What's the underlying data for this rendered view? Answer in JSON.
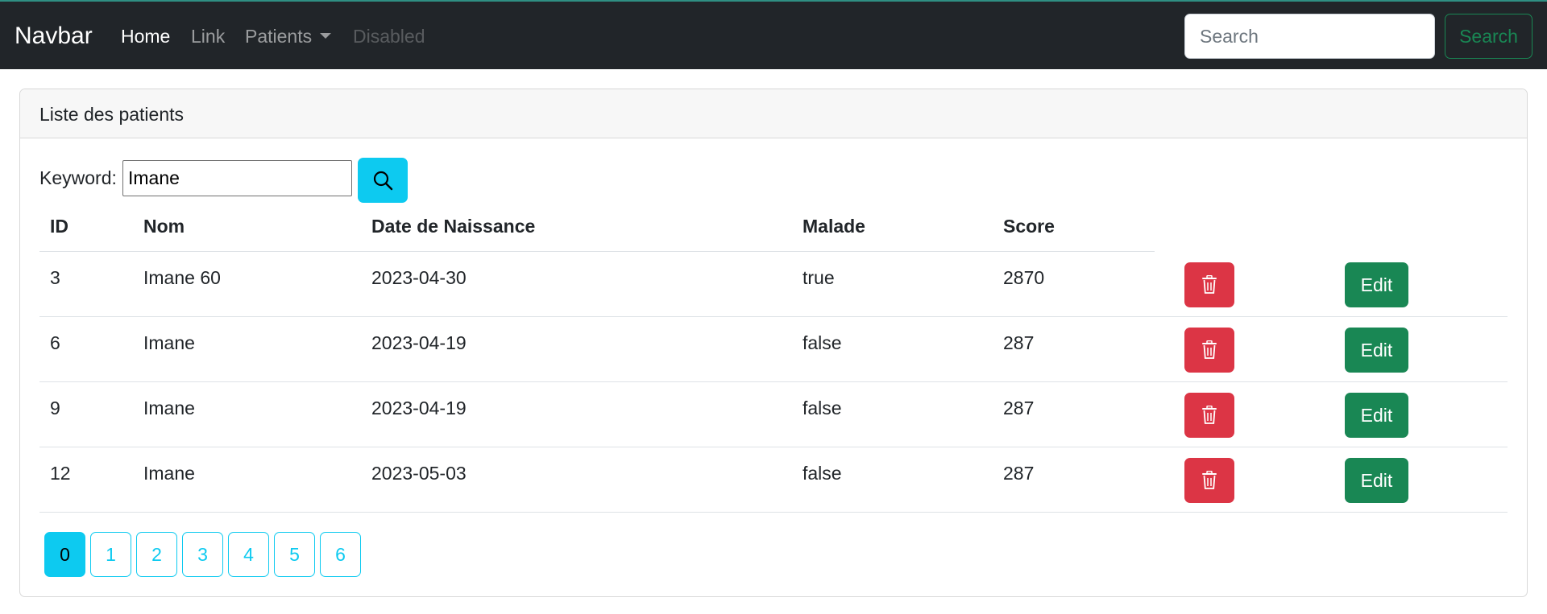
{
  "navbar": {
    "brand": "Navbar",
    "links": [
      {
        "label": "Home"
      },
      {
        "label": "Link"
      },
      {
        "label": "Patients"
      },
      {
        "label": "Disabled"
      }
    ],
    "search_placeholder": "Search",
    "search_button": "Search"
  },
  "card": {
    "header": "Liste des patients",
    "keyword_label": "Keyword:",
    "keyword_value": "Imane"
  },
  "table": {
    "columns": [
      "ID",
      "Nom",
      "Date de Naissance",
      "Malade",
      "Score"
    ],
    "rows": [
      {
        "id": "3",
        "nom": "Imane 60",
        "date": "2023-04-30",
        "malade": "true",
        "score": "2870"
      },
      {
        "id": "6",
        "nom": "Imane",
        "date": "2023-04-19",
        "malade": "false",
        "score": "287"
      },
      {
        "id": "9",
        "nom": "Imane",
        "date": "2023-04-19",
        "malade": "false",
        "score": "287"
      },
      {
        "id": "12",
        "nom": "Imane",
        "date": "2023-05-03",
        "malade": "false",
        "score": "287"
      }
    ],
    "edit_label": "Edit"
  },
  "pagination": {
    "pages": [
      "0",
      "1",
      "2",
      "3",
      "4",
      "5",
      "6"
    ],
    "current": "0"
  },
  "colors": {
    "navbar_bg": "#212529",
    "info": "#0dcaf0",
    "danger": "#dc3545",
    "success": "#198754"
  },
  "icons": {
    "keyword_button": "search-icon",
    "delete_button": "trash-icon"
  }
}
